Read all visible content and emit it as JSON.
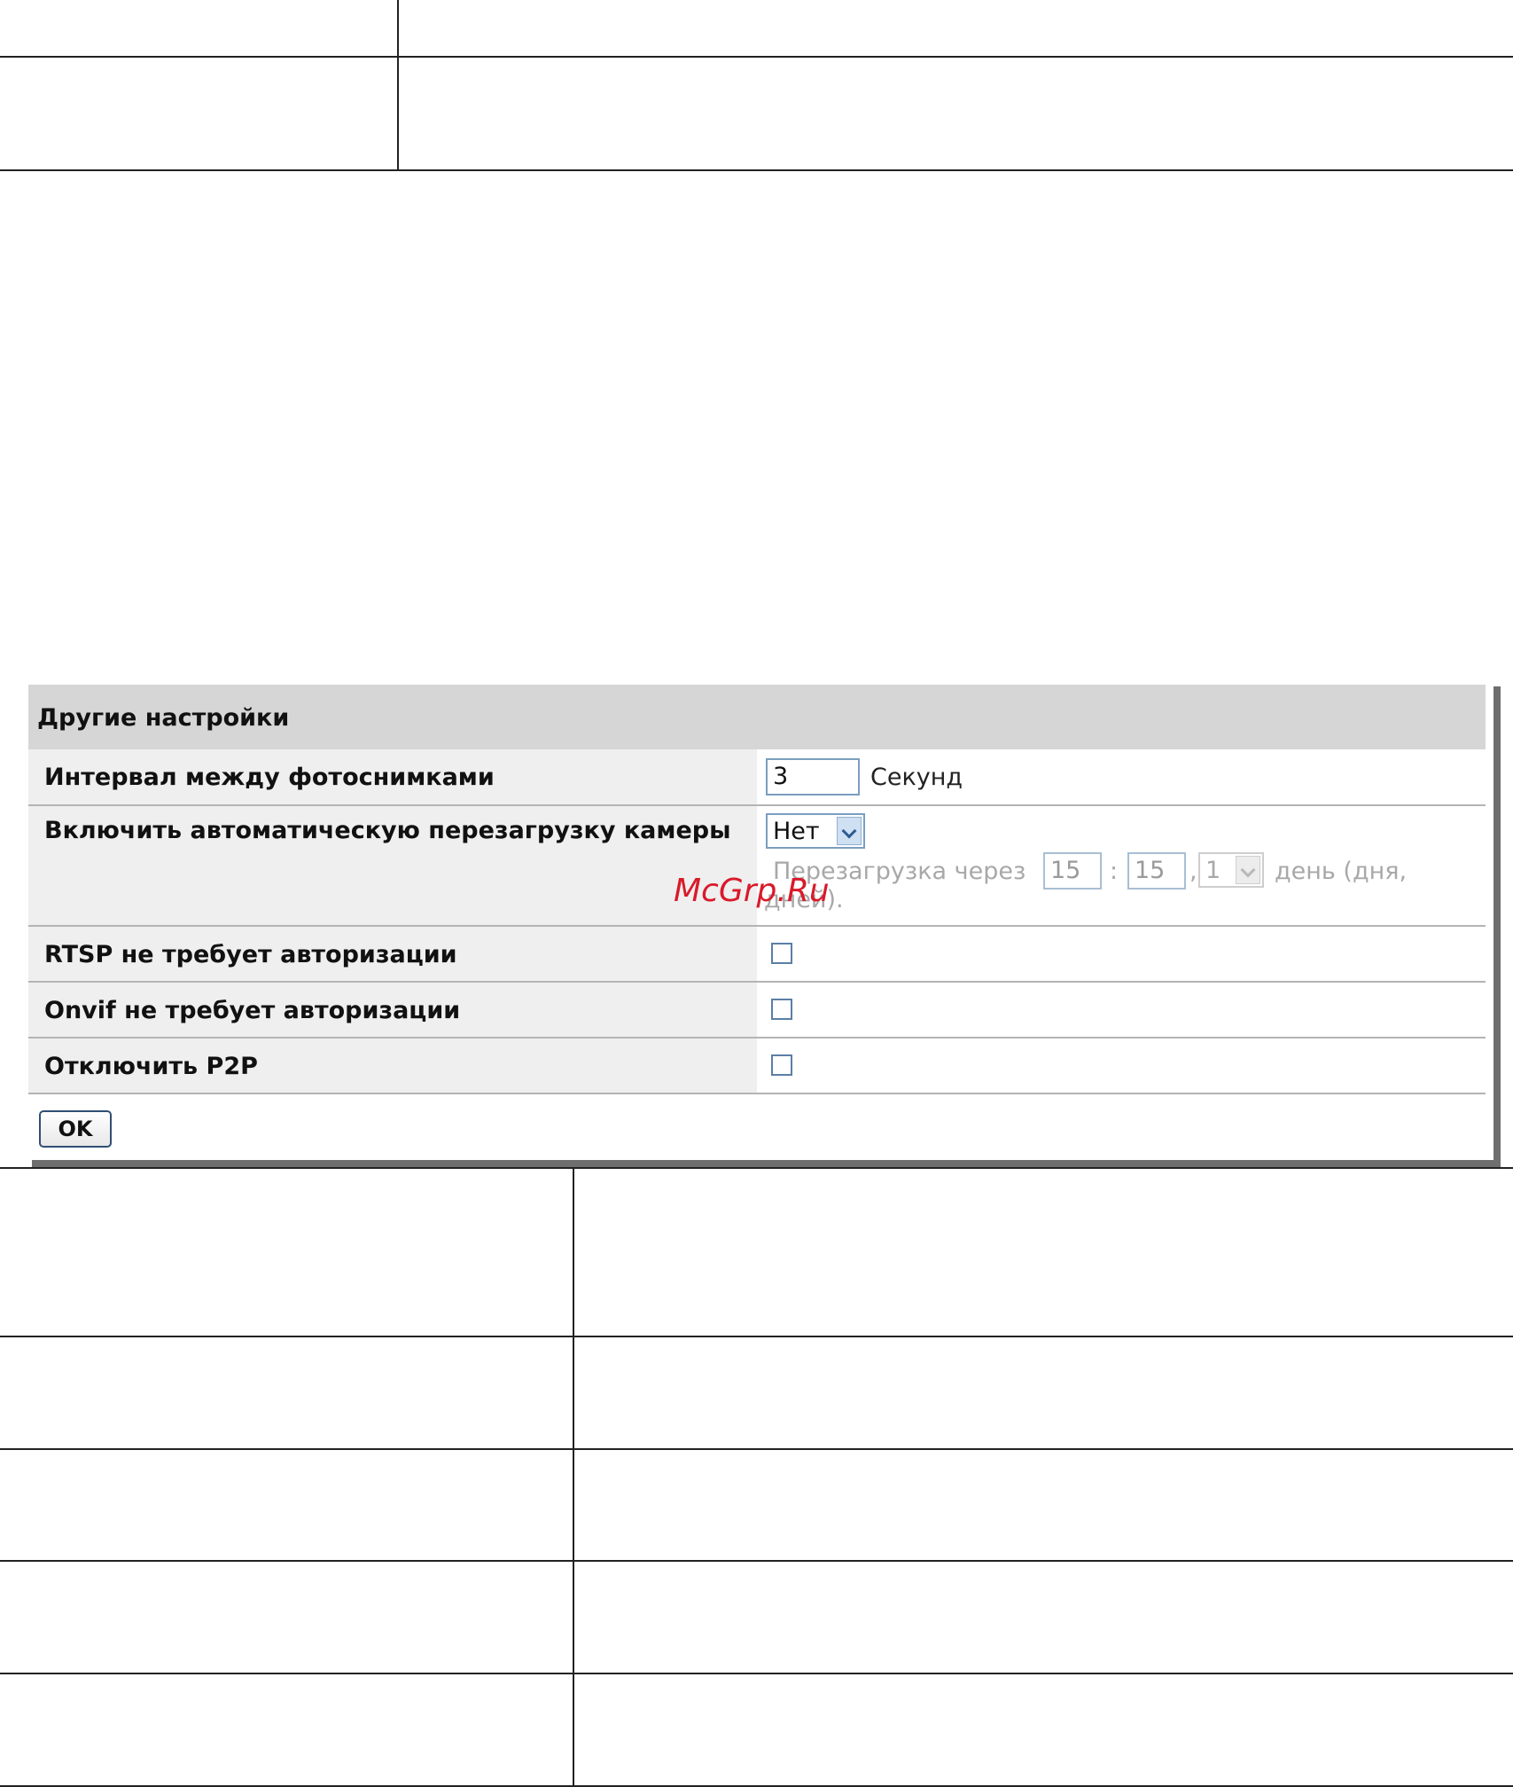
{
  "panel": {
    "title": "Другие настройки",
    "rows": [
      {
        "label": "Интервал между фотоснимками",
        "input_value": "3",
        "unit": "Секунд"
      },
      {
        "label": "Включить автоматическую перезагрузку камеры",
        "select_value": "Нет",
        "reboot_prefix": "Перезагрузка через",
        "hours_value": "15",
        "separator_colon": ":",
        "minutes_value": "15",
        "separator_comma": ",",
        "days_value": "1",
        "reboot_suffix": "день (дня,",
        "reboot_suffix_line2": "дней)."
      },
      {
        "label": "RTSP не требует авторизации",
        "checked": false
      },
      {
        "label": "Onvif не требует авторизации",
        "checked": false
      },
      {
        "label": "Отключить P2P",
        "checked": false
      }
    ],
    "ok_label": "OK"
  },
  "watermark": "McGrp.Ru"
}
